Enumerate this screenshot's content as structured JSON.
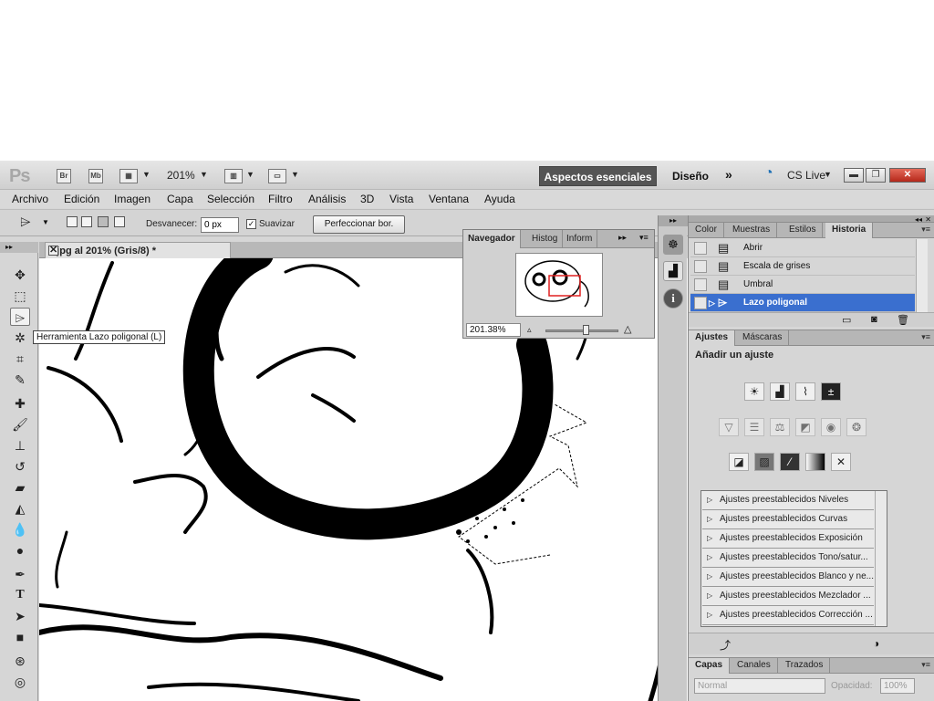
{
  "app": {
    "logo": "Ps",
    "bridge": "Br",
    "minibridge": "Mb",
    "zoom": "201%",
    "workspace_active": "Aspectos esenciales",
    "workspace_other": "Diseño",
    "more": "»",
    "cs_live": "CS Live"
  },
  "menu": [
    "Archivo",
    "Edición",
    "Imagen",
    "Capa",
    "Selección",
    "Filtro",
    "Análisis",
    "3D",
    "Vista",
    "Ventana",
    "Ayuda"
  ],
  "options": {
    "feather_label": "Desvanecer:",
    "feather_value": "0 px",
    "antialias_label": "Suavizar",
    "refine_label": "Perfeccionar bor."
  },
  "tooltip": "Herramienta Lazo poligonal (L)",
  "document": {
    "tab": "1.jpg al 201% (Gris/8) *"
  },
  "navigator": {
    "tabs": [
      "Navegador",
      "Histog",
      "Inform"
    ],
    "zoom": "201.38%"
  },
  "history_panel": {
    "tabs": [
      "Color",
      "Muestras",
      "Estilos",
      "Historia"
    ],
    "items": [
      "Abrir",
      "Escala de grises",
      "Umbral",
      "Lazo poligonal"
    ]
  },
  "adjustments": {
    "tabs": [
      "Ajustes",
      "Máscaras"
    ],
    "heading": "Añadir un ajuste",
    "presets": [
      "Ajustes preestablecidos Niveles",
      "Ajustes preestablecidos Curvas",
      "Ajustes preestablecidos Exposición",
      "Ajustes preestablecidos Tono/satur...",
      "Ajustes preestablecidos Blanco y ne...",
      "Ajustes preestablecidos Mezclador ...",
      "Ajustes preestablecidos Corrección ..."
    ]
  },
  "layers": {
    "tabs": [
      "Capas",
      "Canales",
      "Trazados"
    ],
    "blend": "Normal",
    "opacity_label": "Opacidad:",
    "opacity_value": "100%"
  }
}
